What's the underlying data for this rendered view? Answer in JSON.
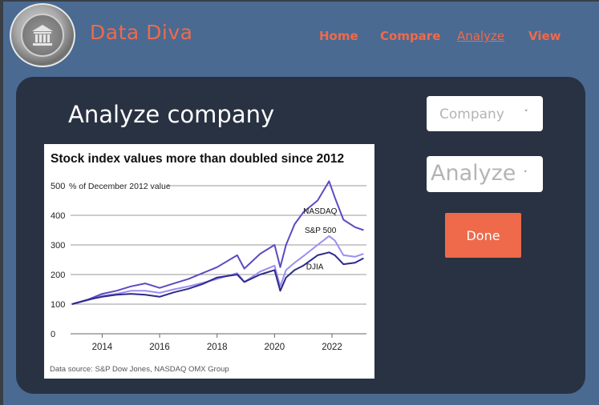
{
  "brand": {
    "name": "Data Diva"
  },
  "nav": {
    "items": [
      {
        "label": "Home"
      },
      {
        "label": "Compare"
      },
      {
        "label": "Analyze"
      },
      {
        "label": "View"
      }
    ]
  },
  "main": {
    "title": "Analyze company",
    "company_select": {
      "value": "Company"
    },
    "analyze_select": {
      "value": "Analyze"
    },
    "done_label": "Done"
  },
  "colors": {
    "accent": "#ee6a4b",
    "header_bg": "#4a6a92",
    "panel_bg": "#283242"
  },
  "chart_data": {
    "type": "line",
    "title": "Stock index values more than doubled since 2012",
    "ylabel": "% of December 2012 value",
    "source": "Data source: S&P Dow Jones, NASDAQ OMX Group",
    "ylim": [
      0,
      500
    ],
    "xlim": [
      2012.9,
      2023.2
    ],
    "yticks": [
      0,
      100,
      200,
      300,
      400,
      500
    ],
    "xticks": [
      2014,
      2016,
      2018,
      2020,
      2022
    ],
    "grid": true,
    "series": [
      {
        "name": "NASDAQ",
        "color": "#5c4bc2",
        "x": [
          2012.95,
          2013.5,
          2014,
          2014.5,
          2015,
          2015.5,
          2016,
          2016.5,
          2017,
          2017.5,
          2018,
          2018.7,
          2018.95,
          2019.5,
          2020,
          2020.2,
          2020.4,
          2020.7,
          2021,
          2021.5,
          2021.9,
          2022.1,
          2022.4,
          2022.8,
          2023.1
        ],
        "y": [
          100,
          115,
          135,
          145,
          160,
          170,
          155,
          170,
          185,
          205,
          225,
          265,
          220,
          270,
          300,
          225,
          300,
          370,
          410,
          450,
          515,
          460,
          385,
          360,
          350
        ]
      },
      {
        "name": "S&P 500",
        "color": "#9b8ef0",
        "x": [
          2012.95,
          2013.5,
          2014,
          2014.5,
          2015,
          2015.5,
          2016,
          2016.5,
          2017,
          2017.5,
          2018,
          2018.7,
          2018.95,
          2019.5,
          2020,
          2020.2,
          2020.4,
          2020.7,
          2021,
          2021.5,
          2021.9,
          2022.1,
          2022.4,
          2022.8,
          2023.1
        ],
        "y": [
          100,
          113,
          128,
          135,
          145,
          145,
          138,
          150,
          160,
          172,
          185,
          205,
          175,
          210,
          230,
          160,
          215,
          240,
          262,
          300,
          330,
          315,
          265,
          260,
          270
        ]
      },
      {
        "name": "DJIA",
        "color": "#2b2a8c",
        "x": [
          2012.95,
          2013.5,
          2014,
          2014.5,
          2015,
          2015.5,
          2016,
          2016.5,
          2017,
          2017.5,
          2018,
          2018.7,
          2018.95,
          2019.5,
          2020,
          2020.2,
          2020.4,
          2020.7,
          2021,
          2021.5,
          2021.9,
          2022.1,
          2022.4,
          2022.8,
          2023.1
        ],
        "y": [
          100,
          115,
          125,
          132,
          135,
          132,
          125,
          140,
          152,
          168,
          190,
          200,
          175,
          200,
          215,
          145,
          190,
          215,
          230,
          265,
          275,
          265,
          235,
          240,
          255
        ]
      }
    ],
    "annotations": [
      {
        "label": "NASDAQ"
      },
      {
        "label": "S&P 500"
      },
      {
        "label": "DJIA"
      }
    ]
  }
}
